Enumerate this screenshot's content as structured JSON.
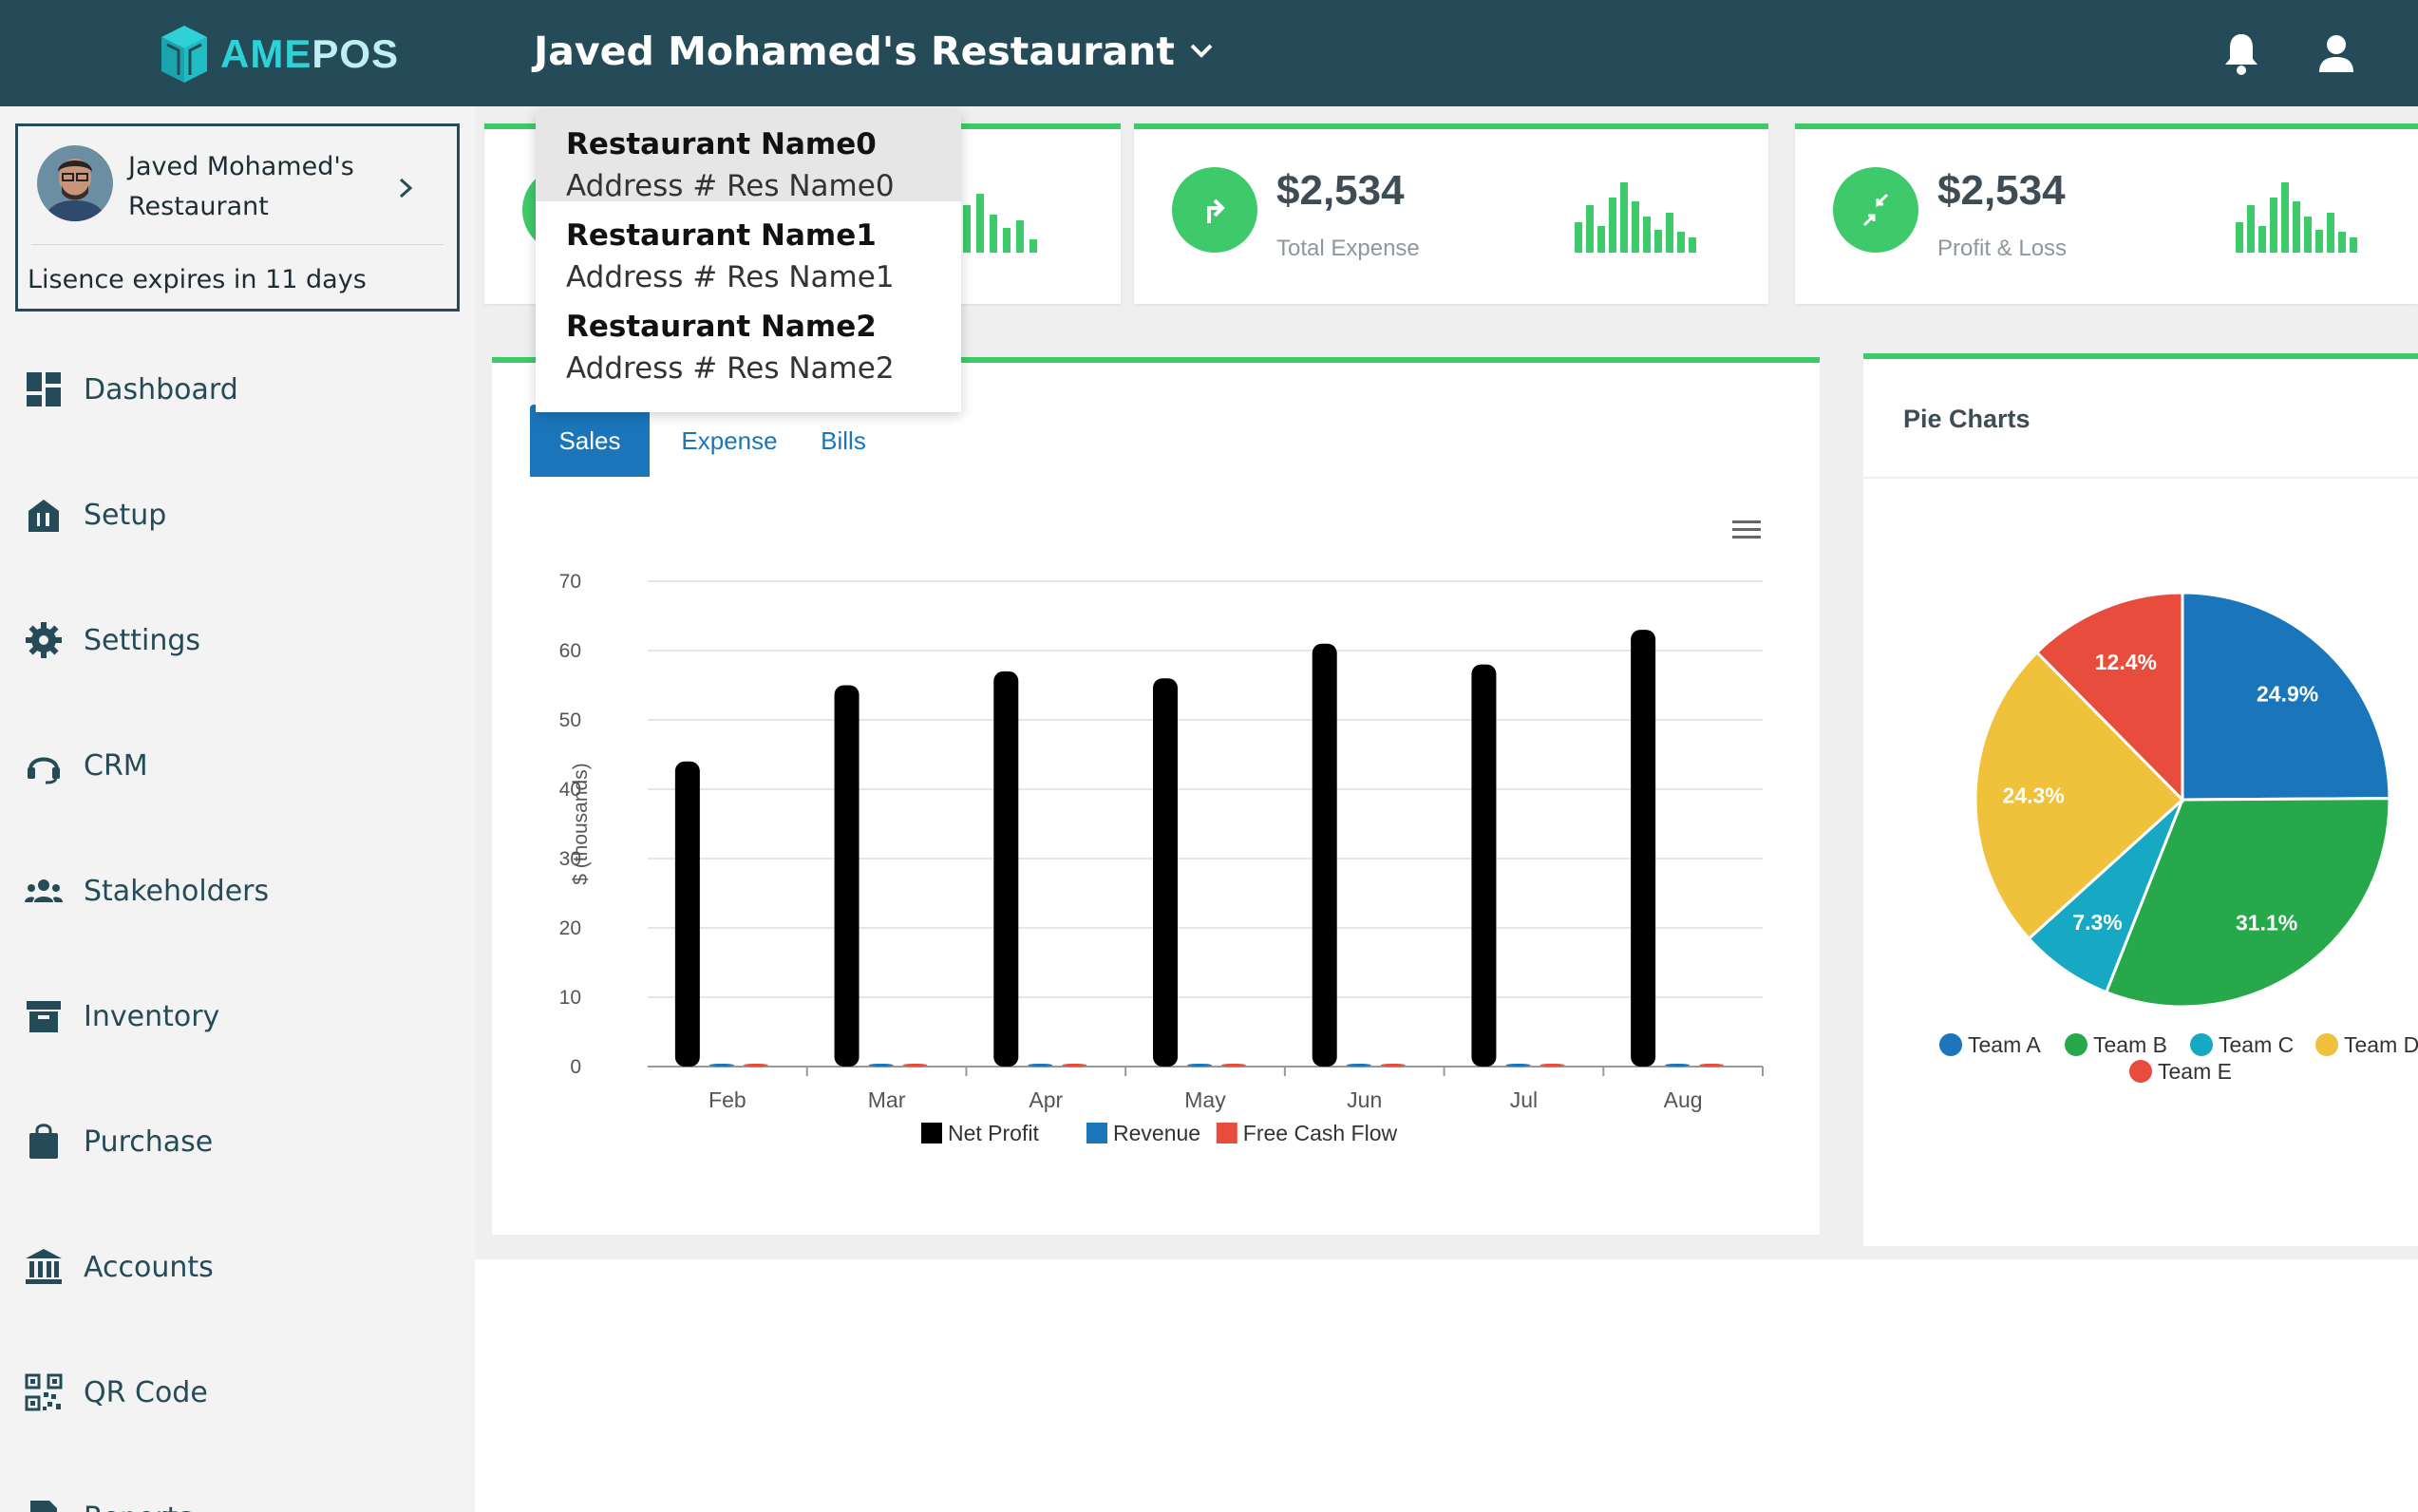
{
  "app": {
    "logo_part1": "AME",
    "logo_part2": "POS"
  },
  "header": {
    "restaurant_name": "Javed Mohamed's Restaurant",
    "icons": [
      "bell-icon",
      "user-icon",
      "chevron-down-icon"
    ]
  },
  "profile": {
    "name": "Javed Mohamed's Restaurant",
    "licence": "Lisence expires in 11 days"
  },
  "sidebar": {
    "items": [
      {
        "label": "Dashboard",
        "icon": "dashboard-icon"
      },
      {
        "label": "Setup",
        "icon": "setup-icon"
      },
      {
        "label": "Settings",
        "icon": "gear-icon"
      },
      {
        "label": "CRM",
        "icon": "headset-icon"
      },
      {
        "label": "Stakeholders",
        "icon": "people-icon"
      },
      {
        "label": "Inventory",
        "icon": "archive-icon"
      },
      {
        "label": "Purchase",
        "icon": "shopping-bag-icon"
      },
      {
        "label": "Accounts",
        "icon": "bank-icon"
      },
      {
        "label": "QR Code",
        "icon": "qr-code-icon"
      },
      {
        "label": "Reports",
        "icon": "report-icon"
      }
    ]
  },
  "dropdown": {
    "items": [
      {
        "name": "Restaurant Name0",
        "address": "Address # Res Name0"
      },
      {
        "name": "Restaurant Name1",
        "address": "Address # Res Name1"
      },
      {
        "name": "Restaurant Name2",
        "address": "Address # Res Name2"
      }
    ]
  },
  "stats": [
    {
      "value": "",
      "label": ""
    },
    {
      "value": "$2,534",
      "label": "Total Expense"
    },
    {
      "value": "$2,534",
      "label": "Profit & Loss"
    }
  ],
  "tabs": {
    "sales": "Sales",
    "expense": "Expense",
    "bills": "Bills"
  },
  "pie": {
    "title": "Pie Charts"
  },
  "colors": {
    "header_bg": "#244b57",
    "accent_green": "#3ec96a",
    "tab_blue": "#1b75bb",
    "net_profit": "#000000",
    "revenue": "#1b75bb",
    "free_cash_flow": "#e74c3c",
    "team_a": "#1b75bb",
    "team_b": "#27a84a",
    "team_c": "#17a9c4",
    "team_d": "#f0c13a",
    "team_e": "#e74c3c"
  },
  "chart_data": [
    {
      "type": "bar",
      "categories": [
        "Feb",
        "Mar",
        "Apr",
        "May",
        "Jun",
        "Jul",
        "Aug"
      ],
      "series": [
        {
          "name": "Net Profit",
          "values": [
            44,
            55,
            57,
            56,
            61,
            58,
            63
          ]
        },
        {
          "name": "Revenue",
          "values": [
            0,
            0,
            0,
            0,
            0,
            0,
            0
          ]
        },
        {
          "name": "Free Cash Flow",
          "values": [
            0,
            0,
            0,
            0,
            0,
            0,
            0
          ]
        }
      ],
      "ylabel": "$ (thousands)",
      "ylim": [
        0,
        70
      ],
      "yticks": [
        "0",
        "10",
        "20",
        "30",
        "40",
        "50",
        "60",
        "70"
      ],
      "legend": "bottom",
      "grid": true
    },
    {
      "type": "pie",
      "title": "Pie Charts",
      "slices": [
        {
          "label": "Team A",
          "value": 24.9,
          "text": "24.9%"
        },
        {
          "label": "Team B",
          "value": 31.1,
          "text": "31.1%"
        },
        {
          "label": "Team C",
          "value": 7.3,
          "text": "7.3%"
        },
        {
          "label": "Team D",
          "value": 24.3,
          "text": "24.3%"
        },
        {
          "label": "Team E",
          "value": 12.4,
          "text": "12.4%"
        }
      ],
      "legend": "bottom"
    }
  ]
}
